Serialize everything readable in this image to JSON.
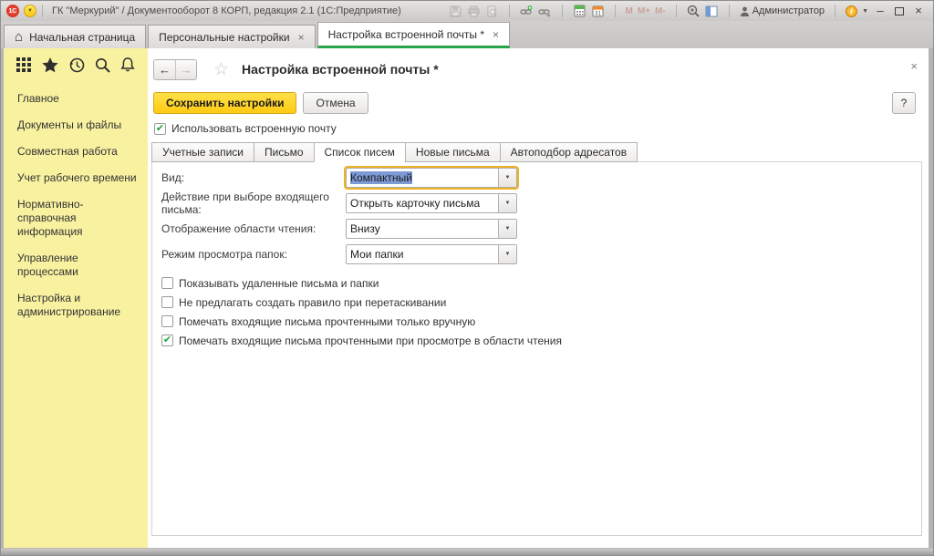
{
  "titlebar": {
    "title": "ГК \"Меркурий\" / Документооборот 8 КОРП, редакция 2.1  (1С:Предприятие)",
    "logo": "1С",
    "user": "Администратор",
    "memory": [
      "M",
      "M+",
      "M-"
    ],
    "calendar_day": "31",
    "info_glyph": "i"
  },
  "glyphs": {
    "menu_caret": "▼",
    "close": "×",
    "minimize": "–",
    "home": "⌂",
    "back": "←",
    "forward": "→",
    "star_outline": "☆",
    "dropdown": "▼",
    "check": "✔"
  },
  "apptabs": [
    {
      "label": "Начальная страница",
      "close": ""
    },
    {
      "label": "Персональные настройки",
      "close": "×"
    },
    {
      "label": "Настройка встроенной почты *",
      "close": "×"
    }
  ],
  "sidebar": {
    "items": [
      "Главное",
      "Документы и файлы",
      "Совместная работа",
      "Учет рабочего времени",
      "Нормативно-справочная информация",
      "Управление процессами",
      "Настройка и администрирование"
    ]
  },
  "page": {
    "title": "Настройка встроенной почты *",
    "save": "Сохранить настройки",
    "cancel": "Отмена",
    "help": "?",
    "use_mail": "Использовать встроенную почту",
    "use_mail_mark": "✔",
    "form_tabs": [
      {
        "label": "Учетные записи"
      },
      {
        "label": "Письмо"
      },
      {
        "label": "Список писем"
      },
      {
        "label": "Новые письма"
      },
      {
        "label": "Автоподбор адресатов"
      }
    ],
    "fields": [
      {
        "label": "Вид:",
        "value": "Компактный"
      },
      {
        "label": "Действие при выборе входящего письма:",
        "value": "Открыть карточку письма"
      },
      {
        "label": "Отображение области чтения:",
        "value": "Внизу"
      },
      {
        "label": "Режим просмотра папок:",
        "value": "Мои папки"
      }
    ],
    "checkboxes": [
      {
        "label": "Показывать удаленные письма и папки",
        "mark": ""
      },
      {
        "label": "Не предлагать создать правило при перетаскивании",
        "mark": ""
      },
      {
        "label": "Помечать входящие письма прочтенными только вручную",
        "mark": ""
      },
      {
        "label": "Помечать входящие письма прочтенными при просмотре в области чтения",
        "mark": "✔"
      }
    ]
  },
  "colors": {
    "accent_yellow": "#fecb13",
    "active_tab_underline": "#27a44c",
    "selection_blue": "#7d9ad6",
    "sidebar_bg": "#f8f1a0",
    "focus_ring": "#eeb322",
    "check_green": "#1ea33c"
  }
}
